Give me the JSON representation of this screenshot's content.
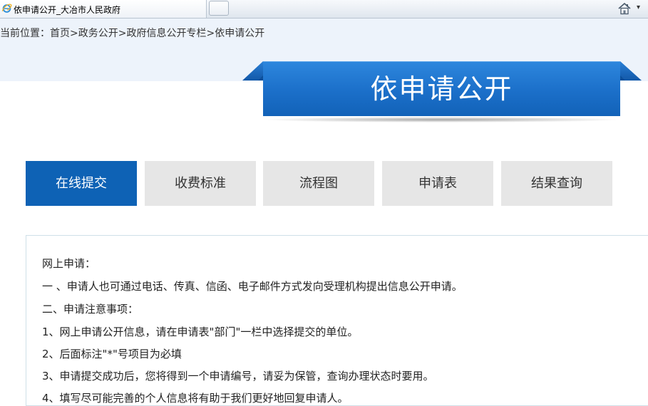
{
  "browser": {
    "tab_title": "依申请公开_大冶市人民政府",
    "home_dropdown": "▾"
  },
  "breadcrumb": {
    "lead": "当前位置：",
    "items": [
      "首页",
      "政务公开",
      "政府信息公开专栏",
      "依申请公开"
    ],
    "separator": ">"
  },
  "banner": {
    "title": "依申请公开"
  },
  "tabs": [
    {
      "label": "在线提交",
      "active": true
    },
    {
      "label": "收费标准",
      "active": false
    },
    {
      "label": "流程图",
      "active": false
    },
    {
      "label": "申请表",
      "active": false
    },
    {
      "label": "结果查询",
      "active": false
    }
  ],
  "content": {
    "lines": [
      "网上申请：",
      "一 、申请人也可通过电话、传真、信函、电子邮件方式发向受理机构提出信息公开申请。",
      "二、申请注意事项：",
      "1、网上申请公开信息，请在申请表\"部门\"一栏中选择提交的单位。",
      "2、后面标注\"*\"号项目为必填",
      "3、申请提交成功后，您将得到一个申请编号，请妥为保管，查询办理状态时要用。",
      "4、填写尽可能完善的个人信息将有助于我们更好地回复申请人。"
    ]
  },
  "colors": {
    "tab_active_bg": "#0e62b5",
    "tab_inactive_bg": "#e6e6e6",
    "ribbon_blue": "#1b6fc9",
    "ribbon_dark": "#0b4f9a",
    "header_band": "#edf3fb"
  },
  "icons": {
    "tab_favicon": "ie-icon",
    "home": "home-icon"
  }
}
